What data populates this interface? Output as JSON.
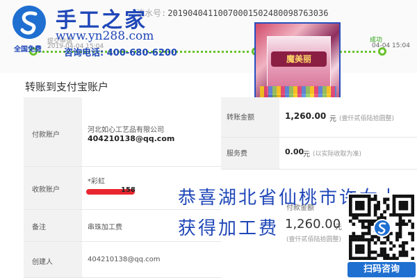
{
  "header": {
    "serial_label": "流水号:",
    "serial_number": "20190404110070001502480098763036",
    "step_left_label": "提交申请",
    "step_left_time": "2019-04-04 15:04",
    "step_right_label": "成功",
    "step_right_time": "04-04 15:04",
    "left_truncated_text": "全国免费"
  },
  "logo": {
    "title": "手工之家",
    "url": "www.yn288.com",
    "phone_label": "咨询电话:",
    "phone": "400-680-6200"
  },
  "photo": {
    "brand_text": "魔美丽"
  },
  "section": {
    "title": "转账到支付宝账户"
  },
  "table": {
    "payer_label": "付款账户",
    "payer_name": "河北如心工艺品有限公司",
    "payer_email": "404210138@qq.com",
    "amount_label": "转账金额",
    "amount_value": "1,260.00",
    "amount_unit": "元",
    "amount_note": "(壹仟贰佰陆拾圆整)",
    "fee_label": "服务费",
    "fee_value": "0.00",
    "fee_unit": "元",
    "fee_note": "(以实际收取为准)",
    "payee_label": "收款账户",
    "payee_name": "*彩虹",
    "payee_partial": "158",
    "remark_label": "备注",
    "remark_value": "串珠加工费",
    "creator_label": "创建人",
    "creator_value": "404210138@qq.com"
  },
  "overlay": {
    "line1": "恭喜湖北省仙桃市许女士",
    "line2": "获得加工费"
  },
  "paid": {
    "label": "付款金额",
    "value": "1,260.00",
    "unit": "元",
    "note": "(壹仟贰佰陆拾圆整)"
  },
  "qr": {
    "caption": "扫码咨询"
  },
  "colors": {
    "brand_blue": "#1f47b8",
    "flow_green": "#67c22a",
    "redact_red": "#e8262f"
  }
}
